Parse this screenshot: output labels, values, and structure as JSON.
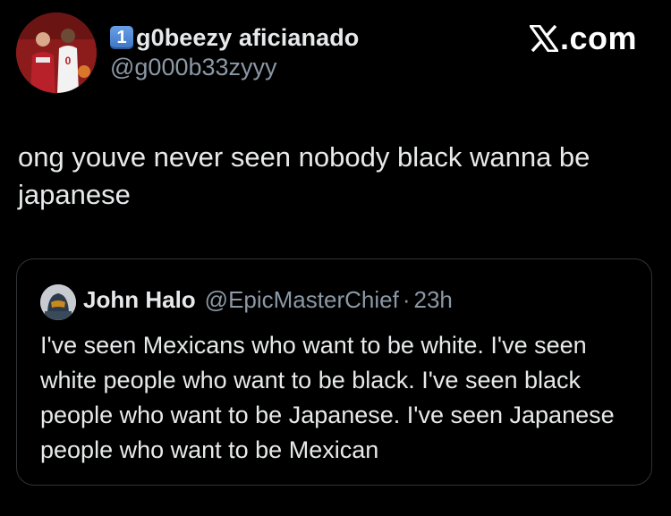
{
  "tweet": {
    "avatar_icon": "profile-photo",
    "keycap": "1",
    "display_name": "g0beezy aficianado",
    "handle": "@g000b33zyyy",
    "text": "ong youve never seen nobody black wanna be japanese"
  },
  "source": {
    "icon": "x-logo-icon",
    "label": ".com"
  },
  "quote": {
    "avatar_icon": "halo-helmet-avatar",
    "name": "John Halo",
    "handle": "@EpicMasterChief",
    "separator": "·",
    "time": "23h",
    "text": "I've seen Mexicans who want to be white. I've seen white people who want to be black. I've seen black people who want to be Japanese. I've seen Japanese people who want to be Mexican"
  },
  "colors": {
    "background": "#000000",
    "primary_text": "#e7e9ea",
    "secondary_text": "#8b98a5",
    "quote_border": "#2f3336",
    "keycap": "#4a82d4"
  }
}
